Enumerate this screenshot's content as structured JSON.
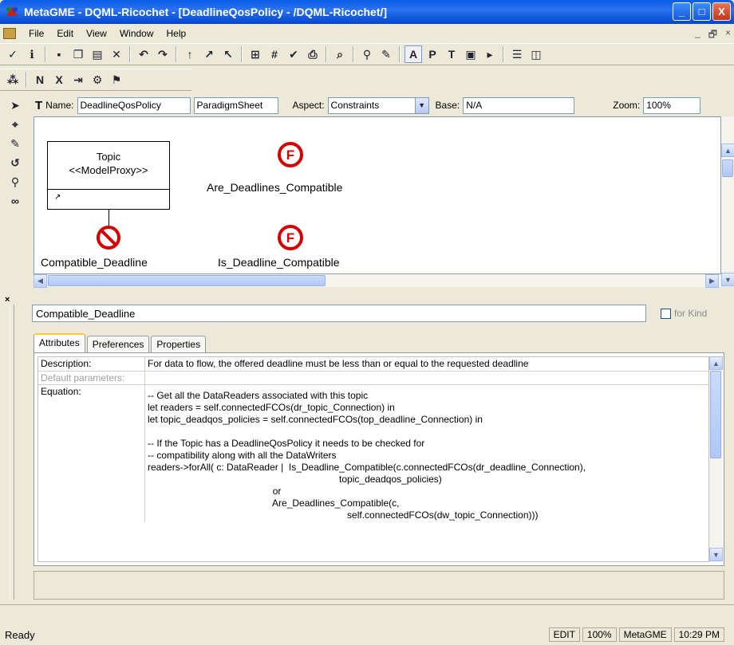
{
  "window": {
    "title": "MetaGME - DQML-Ricochet - [DeadlineQosPolicy - /DQML-Ricochet/]",
    "buttons": {
      "minimize": "_",
      "maximize": "□",
      "close": "X"
    }
  },
  "menubar": {
    "items": [
      "File",
      "Edit",
      "View",
      "Window",
      "Help"
    ],
    "mdi_buttons": {
      "minimize": "_",
      "restore": "🗗",
      "close": "×"
    }
  },
  "toolbar1": {
    "icons": [
      "check-icon",
      "info-icon",
      "save-icon",
      "copy-icon",
      "paste-icon",
      "delete-icon",
      "undo-icon",
      "redo-icon",
      "up-icon",
      "up-right-icon",
      "up-left-icon",
      "register-icon",
      "grid-icon",
      "checkmark-icon",
      "print-icon",
      "find-icon",
      "zoom-icon",
      "pen-icon",
      "aspect-a-icon",
      "aspect-p-icon",
      "aspect-t-icon",
      "aspect-box-icon",
      "aspect-arrow-icon",
      "list-icon",
      "split-icon"
    ]
  },
  "toolbar2": {
    "icons": [
      "palette-icon",
      "name-icon",
      "x-icon",
      "connect-icon",
      "gear-icon",
      "model-icon"
    ]
  },
  "model_header": {
    "name_label": "Name:",
    "name_value": "DeadlineQosPolicy",
    "paradigm_value": "ParadigmSheet",
    "aspect_label": "Aspect:",
    "aspect_value": "Constraints",
    "base_label": "Base:",
    "base_value": "N/A",
    "zoom_label": "Zoom:",
    "zoom_value": "100%"
  },
  "canvas": {
    "topic_box": {
      "title": "Topic",
      "stereotype": "<<ModelProxy>>"
    },
    "labels": {
      "are_compatible": "Are_Deadlines_Compatible",
      "compatible_deadline": "Compatible_Deadline",
      "is_compatible": "Is_Deadline_Compatible"
    },
    "colors": {
      "constraint_red": "#d40000"
    }
  },
  "lower_panel": {
    "object_name": "Compatible_Deadline",
    "for_kind_label": "for Kind",
    "tabs": [
      "Attributes",
      "Preferences",
      "Properties"
    ],
    "attributes": [
      {
        "key": "Description:",
        "value": "For data to flow, the offered deadline must be less than or equal to the requested deadline"
      },
      {
        "key": "Default parameters:",
        "value": ""
      },
      {
        "key": "Equation:",
        "value": "-- Get all the DataReaders associated with this topic\nlet readers = self.connectedFCOs(dr_topic_Connection) in\nlet topic_deadqos_policies = self.connectedFCOs(top_deadline_Connection) in\n\n-- If the Topic has a DeadlineQosPolicy it needs to be checked for\n-- compatibility along with all the DataWriters\nreaders->forAll( c: DataReader |  Is_Deadline_Compatible(c.connectedFCOs(dr_deadline_Connection),\n                                                                        topic_deadqos_policies)\n                                               or\n                                               Are_Deadlines_Compatible(c,\n                                                                           self.connectedFCOs(dw_topic_Connection)))"
      }
    ]
  },
  "statusbar": {
    "text": "Ready",
    "cells": [
      "EDIT",
      "100%",
      "MetaGME",
      "10:29 PM"
    ]
  }
}
